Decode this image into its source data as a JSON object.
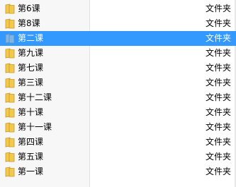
{
  "colors": {
    "selection": "#3399ff",
    "folder_yellow": "#f2c94c",
    "folder_selected": "#7fb6e6"
  },
  "files": [
    {
      "name": "第6课",
      "type": "文件夹",
      "icon": "folder-icon",
      "selected": false
    },
    {
      "name": "第8课",
      "type": "文件夹",
      "icon": "folder-icon",
      "selected": false
    },
    {
      "name": "第二课",
      "type": "文件夹",
      "icon": "folder-icon",
      "selected": true
    },
    {
      "name": "第九课",
      "type": "文件夹",
      "icon": "folder-icon",
      "selected": false
    },
    {
      "name": "第七课",
      "type": "文件夹",
      "icon": "folder-icon",
      "selected": false
    },
    {
      "name": "第三课",
      "type": "文件夹",
      "icon": "folder-icon",
      "selected": false
    },
    {
      "name": "第十二课",
      "type": "文件夹",
      "icon": "folder-icon",
      "selected": false
    },
    {
      "name": "第十课",
      "type": "文件夹",
      "icon": "folder-icon",
      "selected": false
    },
    {
      "name": "第十一课",
      "type": "文件夹",
      "icon": "folder-icon",
      "selected": false
    },
    {
      "name": "第四课",
      "type": "文件夹",
      "icon": "folder-icon",
      "selected": false
    },
    {
      "name": "第五课",
      "type": "文件夹",
      "icon": "folder-icon",
      "selected": false
    },
    {
      "name": "第一课",
      "type": "文件夹",
      "icon": "folder-icon",
      "selected": false
    }
  ]
}
